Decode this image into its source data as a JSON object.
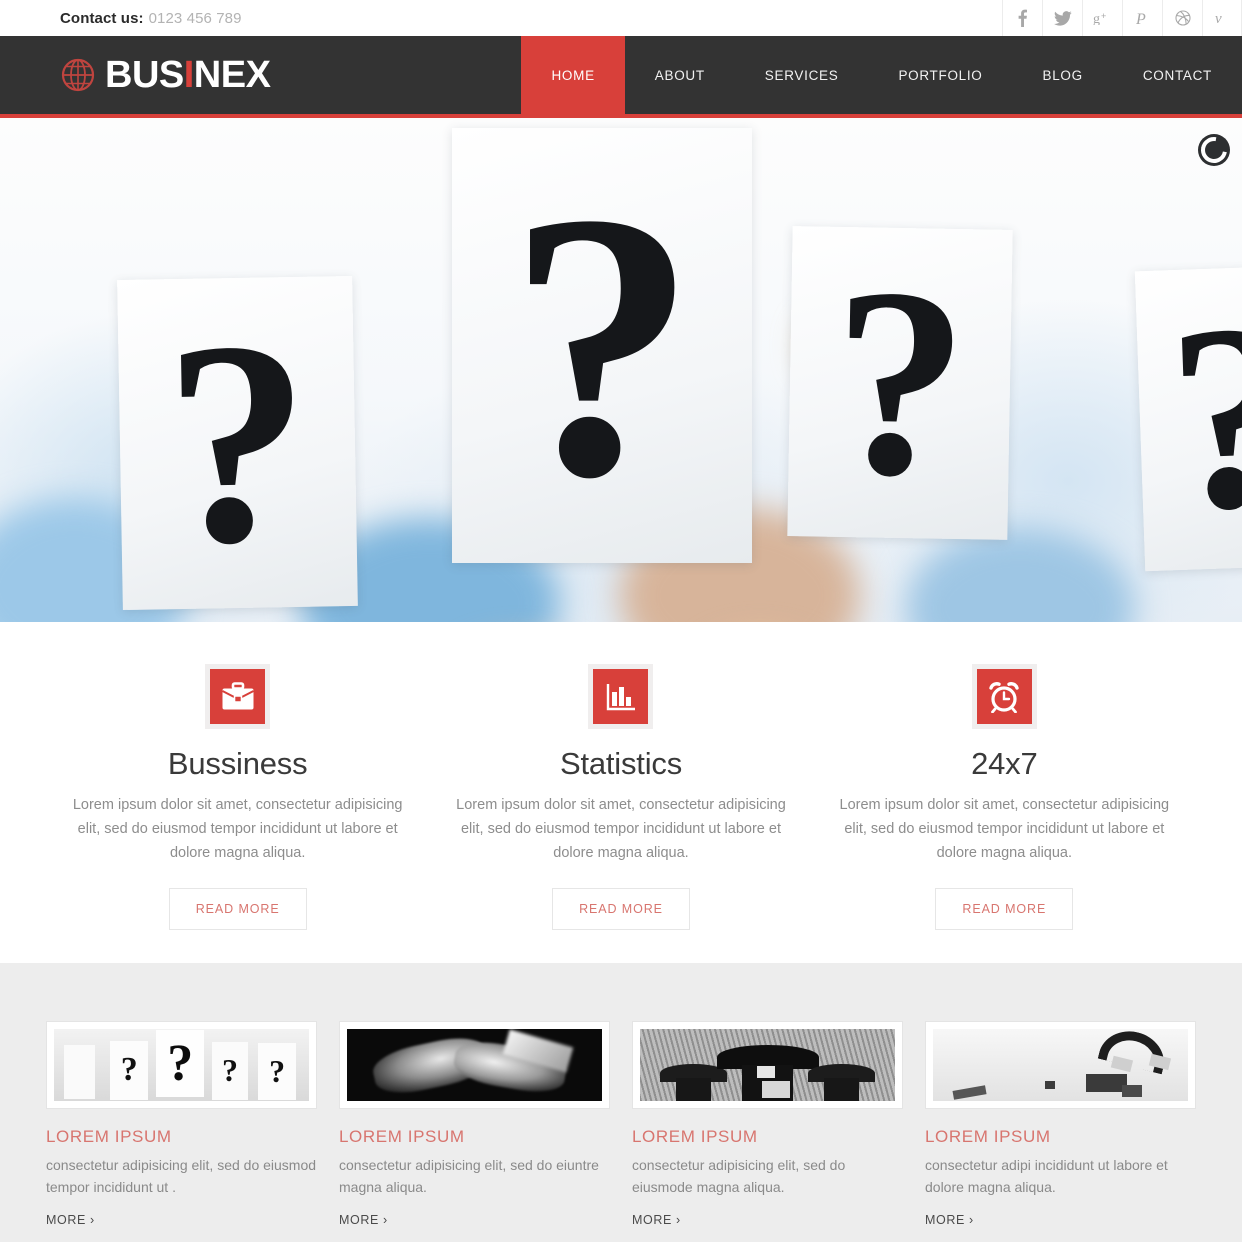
{
  "topbar": {
    "contact_label": "Contact us:",
    "contact_phone": "0123 456 789",
    "social": [
      {
        "name": "facebook-icon",
        "glyph": "f"
      },
      {
        "name": "twitter-icon",
        "glyph": "t"
      },
      {
        "name": "google-plus-icon",
        "glyph": "g+"
      },
      {
        "name": "pinterest-icon",
        "glyph": "P"
      },
      {
        "name": "dribbble-icon",
        "glyph": "d"
      },
      {
        "name": "vimeo-icon",
        "glyph": "v"
      }
    ]
  },
  "header": {
    "logo_text_1": "BUS",
    "logo_accent": "I",
    "logo_text_2": "NEX",
    "logo_icon": "globe-icon",
    "nav": [
      {
        "label": "HOME",
        "active": true
      },
      {
        "label": "ABOUT",
        "active": false
      },
      {
        "label": "SERVICES",
        "active": false
      },
      {
        "label": "PORTFOLIO",
        "active": false
      },
      {
        "label": "BLOG",
        "active": false
      },
      {
        "label": "CONTACT",
        "active": false
      }
    ]
  },
  "hero": {
    "image_description": "People holding white paper sheets with large black question marks",
    "loader_icon": "loading-spinner-icon",
    "question_mark": "?"
  },
  "services": [
    {
      "icon": "briefcase-icon",
      "title": "Bussiness",
      "desc": "Lorem ipsum dolor sit amet, consectetur adipisicing elit, sed do eiusmod tempor incididunt ut labore et dolore magna aliqua.",
      "button": "READ MORE"
    },
    {
      "icon": "bar-chart-icon",
      "title": "Statistics",
      "desc": "Lorem ipsum dolor sit amet, consectetur adipisicing elit, sed do eiusmod tempor incididunt ut labore et dolore magna aliqua.",
      "button": "READ MORE"
    },
    {
      "icon": "alarm-clock-icon",
      "title": "24x7",
      "desc": "Lorem ipsum dolor sit amet, consectetur adipisicing elit, sed do eiusmod tempor incididunt ut labore et dolore magna aliqua.",
      "button": "READ MORE"
    }
  ],
  "grid": [
    {
      "thumb": "question-marks-thumbnail",
      "title": "LOREM IPSUM",
      "desc": "consectetur adipisicing elit, sed do eiusmod tempor incididunt ut .",
      "more": "MORE ›"
    },
    {
      "thumb": "handshake-thumbnail",
      "title": "LOREM IPSUM",
      "desc": "consectetur adipisicing elit, sed do eiuntre magna aliqua.",
      "more": "MORE ›"
    },
    {
      "thumb": "umbrella-businessmen-thumbnail",
      "title": "LOREM IPSUM",
      "desc": "consectetur adipisicing elit, sed do eiusmode magna aliqua.",
      "more": "MORE ›"
    },
    {
      "thumb": "magnet-thumbnail",
      "title": "LOREM IPSUM",
      "desc": "consectetur adipi incididunt ut labore et dolore magna aliqua.",
      "more": "MORE ›"
    }
  ],
  "colors": {
    "accent_red": "#d8403a",
    "header_dark": "#333333",
    "section_gray": "#ededed",
    "muted_text": "#8d8d8d"
  }
}
